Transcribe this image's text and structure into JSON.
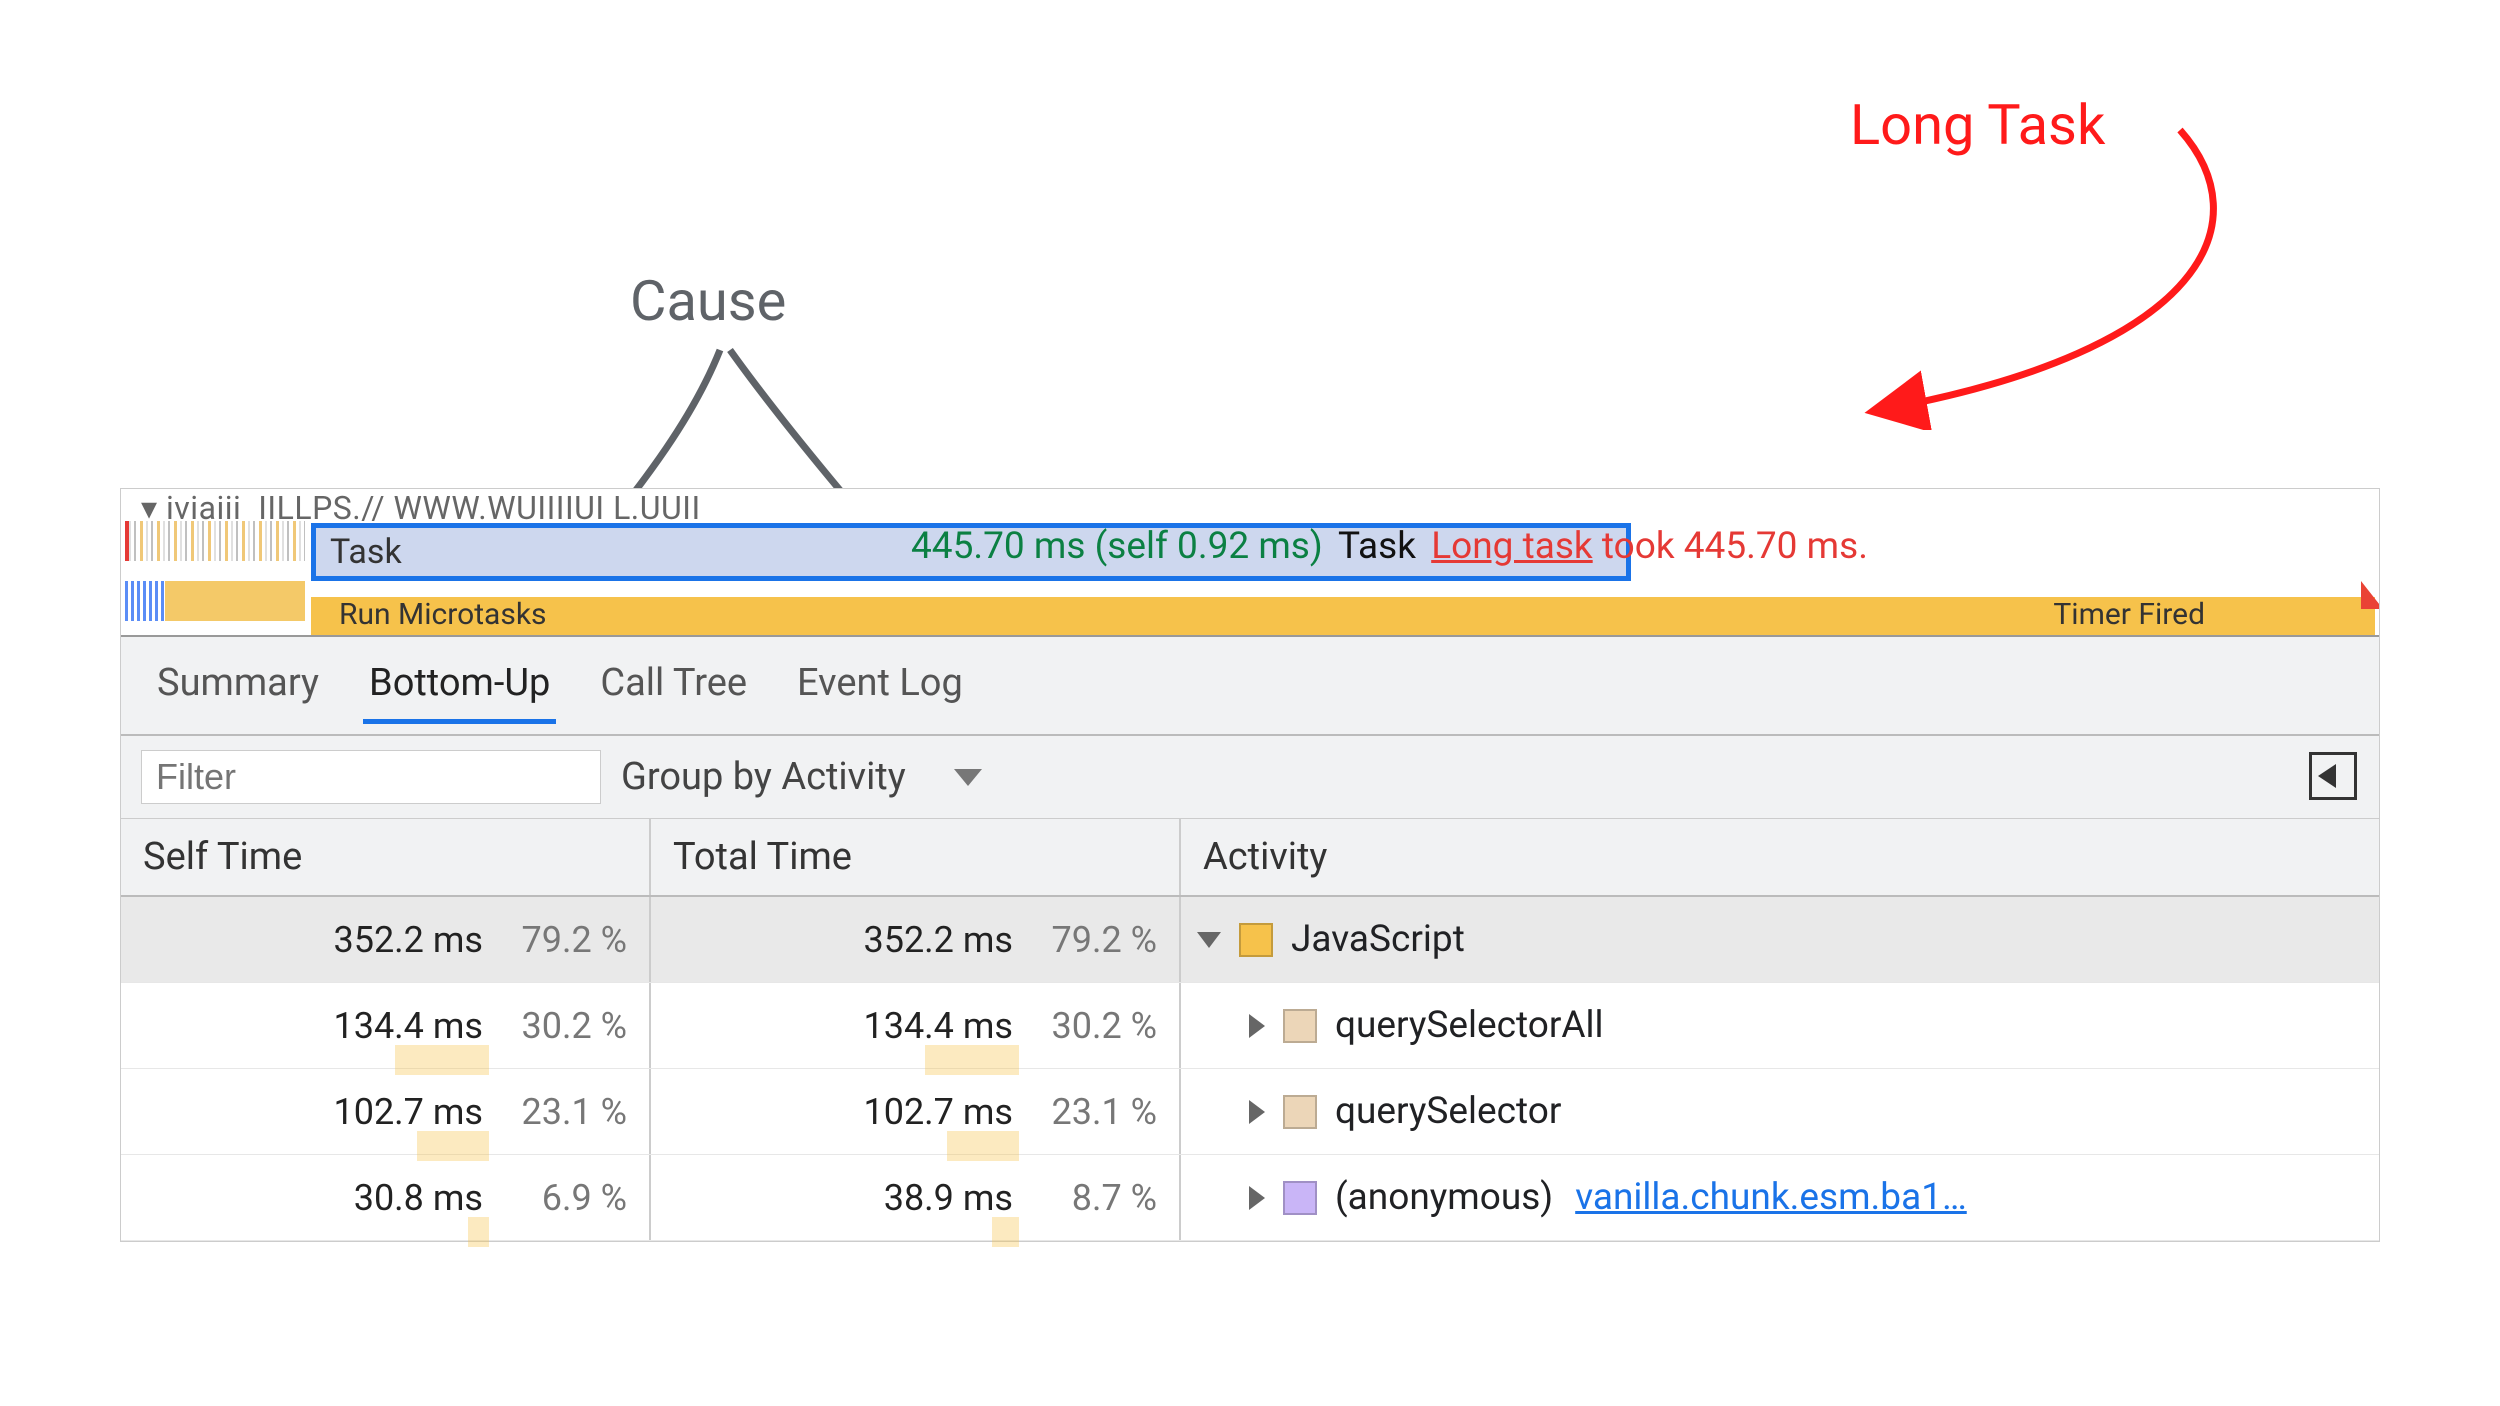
{
  "annotations": {
    "long_task": "Long Task",
    "cause": "Cause"
  },
  "flame": {
    "main_label": "iviaiii",
    "main_url_prefix": "IILLPS.// WWW.WUIIIIUI L.UUII",
    "task_label": "Task",
    "task_duration": "445.70 ms (self 0.92 ms)",
    "task_name": "Task",
    "long_task_link": "Long task",
    "long_task_took": "took 445.70 ms.",
    "run_microtasks": "Run Microtasks",
    "timer_fired": "Timer Fired"
  },
  "tabs": {
    "summary": "Summary",
    "bottom_up": "Bottom-Up",
    "call_tree": "Call Tree",
    "event_log": "Event Log"
  },
  "filter": {
    "placeholder": "Filter",
    "group_by": "Group by Activity"
  },
  "columns": {
    "self_time": "Self Time",
    "total_time": "Total Time",
    "activity": "Activity"
  },
  "rows": [
    {
      "self_ms": "352.2 ms",
      "self_pct": "79.2 %",
      "self_bar": 79.2,
      "total_ms": "352.2 ms",
      "total_pct": "79.2 %",
      "total_bar": 79.2,
      "indent": 0,
      "disclosure": "down",
      "swatch": "yellow",
      "activity": "JavaScript",
      "source": ""
    },
    {
      "self_ms": "134.4 ms",
      "self_pct": "30.2 %",
      "self_bar": 30.2,
      "total_ms": "134.4 ms",
      "total_pct": "30.2 %",
      "total_bar": 30.2,
      "indent": 1,
      "disclosure": "right",
      "swatch": "cream",
      "activity": "querySelectorAll",
      "source": ""
    },
    {
      "self_ms": "102.7 ms",
      "self_pct": "23.1 %",
      "self_bar": 23.1,
      "total_ms": "102.7 ms",
      "total_pct": "23.1 %",
      "total_bar": 23.1,
      "indent": 1,
      "disclosure": "right",
      "swatch": "cream",
      "activity": "querySelector",
      "source": ""
    },
    {
      "self_ms": "30.8 ms",
      "self_pct": "6.9 %",
      "self_bar": 6.9,
      "total_ms": "38.9 ms",
      "total_pct": "8.7 %",
      "total_bar": 8.7,
      "indent": 1,
      "disclosure": "right",
      "swatch": "purple",
      "activity": "(anonymous)",
      "source": "vanilla.chunk.esm.ba1…"
    }
  ]
}
